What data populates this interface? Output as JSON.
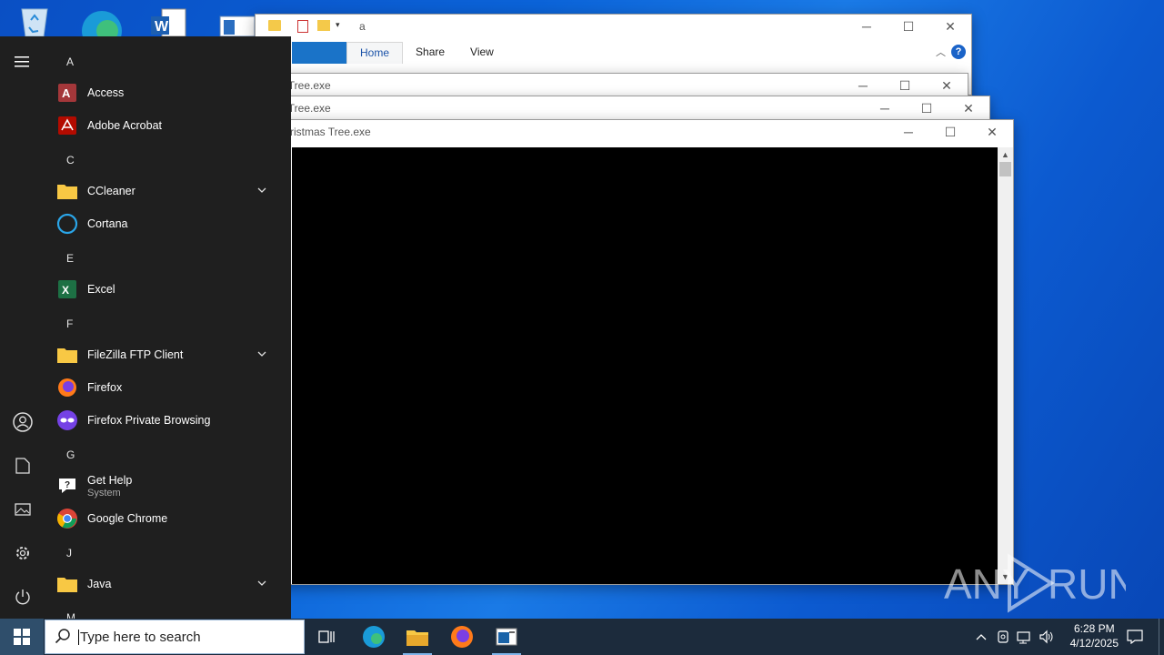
{
  "desktop": {
    "icons": [
      "recycle-bin",
      "microsoft-edge",
      "word-document",
      "file"
    ]
  },
  "explorer_window": {
    "title": "a",
    "tabs": [
      "Home",
      "Share",
      "View"
    ],
    "active_tab": "Home"
  },
  "stack_windows": [
    {
      "title": "as Tree.exe"
    },
    {
      "title": "as Tree.exe"
    }
  ],
  "console_window": {
    "title": "ristmas Tree.exe"
  },
  "start_menu": {
    "sections": [
      {
        "letter": "A",
        "apps": [
          {
            "name": "Access"
          },
          {
            "name": "Adobe Acrobat"
          }
        ]
      },
      {
        "letter": "C",
        "apps": [
          {
            "name": "CCleaner",
            "expandable": true
          },
          {
            "name": "Cortana"
          }
        ]
      },
      {
        "letter": "E",
        "apps": [
          {
            "name": "Excel"
          }
        ]
      },
      {
        "letter": "F",
        "apps": [
          {
            "name": "FileZilla FTP Client",
            "expandable": true
          },
          {
            "name": "Firefox"
          },
          {
            "name": "Firefox Private Browsing"
          }
        ]
      },
      {
        "letter": "G",
        "apps": [
          {
            "name": "Get Help",
            "sub": "System"
          },
          {
            "name": "Google Chrome"
          }
        ]
      },
      {
        "letter": "J",
        "apps": [
          {
            "name": "Java",
            "expandable": true
          }
        ]
      },
      {
        "letter": "M",
        "apps": []
      }
    ]
  },
  "taskbar": {
    "search_placeholder": "Type here to search",
    "time": "6:28 PM",
    "date": "4/12/2025"
  },
  "watermark": {
    "left": "ANY",
    "right": "RUN"
  },
  "colors": {
    "accent": "#1a73c8",
    "start_bg": "#1f1f1f",
    "taskbar_bg": "#1c2b3c"
  }
}
